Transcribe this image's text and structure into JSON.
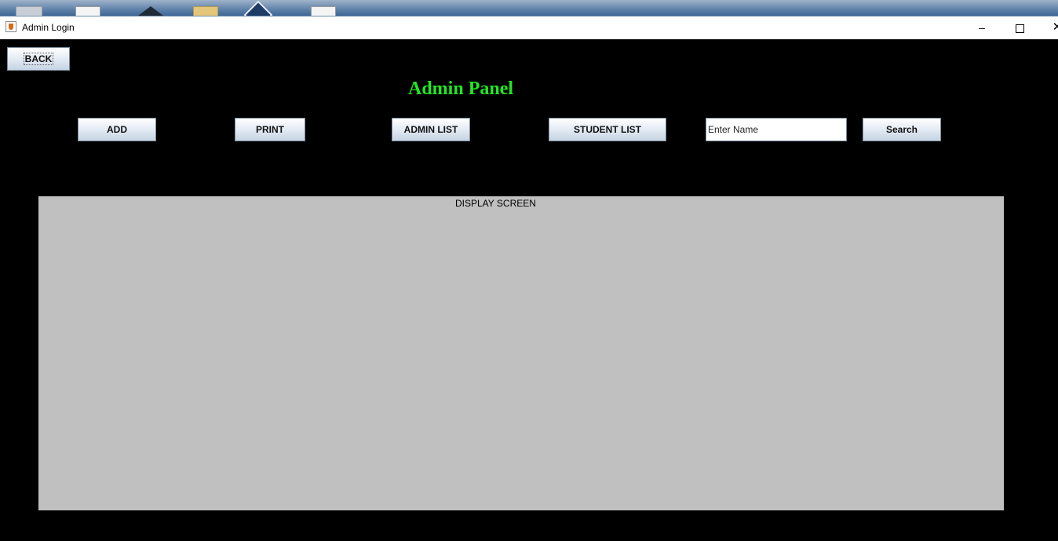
{
  "window": {
    "title": "Admin Login",
    "controls": {
      "minimize": "–",
      "close": "✕"
    }
  },
  "toolbar": {
    "back_label": "BACK"
  },
  "panel": {
    "title": "Admin Panel",
    "title_color": "#22e722"
  },
  "actions": {
    "add_label": "ADD",
    "print_label": "PRINT",
    "admin_list_label": "ADMIN LIST",
    "student_list_label": "STUDENT LIST",
    "search_label": "Search"
  },
  "search": {
    "value": "Enter Name"
  },
  "display": {
    "label": "DISPLAY SCREEN"
  },
  "colors": {
    "background": "#000000",
    "display_area": "#c0c0c0"
  }
}
